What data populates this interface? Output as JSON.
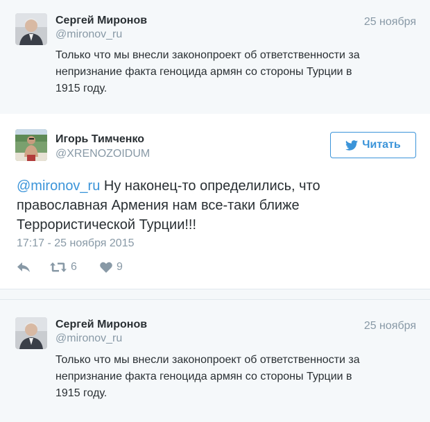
{
  "tweet_top": {
    "name": "Сергей Миронов",
    "handle": "@mironov_ru",
    "date": "25 ноября",
    "text_lines": [
      "Только что мы внесли законопроект об ответственности за",
      "непризнание факта геноцида армян со стороны Турции в",
      "1915 году."
    ],
    "avatar_icon": "avatar-portrait"
  },
  "tweet_main": {
    "name": "Игорь Тимченко",
    "handle": "@XRENOZOIDUM",
    "follow_label": "Читать",
    "mention": "@mironov_ru",
    "text_rest_line1": " Ну наконец-то определились, что",
    "text_line2": "православная Армения нам все-таки ближе",
    "text_line3": "Террористической Турции!!!",
    "timestamp": "17:17 - 25 ноября 2015",
    "retweets": "6",
    "likes": "9",
    "accent_color": "#3b94d9"
  },
  "tweet_bottom": {
    "name": "Сергей Миронов",
    "handle": "@mironov_ru",
    "date": "25 ноября",
    "text_lines": [
      "Только что мы внесли законопроект об ответственности за",
      "непризнание факта геноцида армян со стороны Турции в",
      "1915 году."
    ],
    "avatar_icon": "avatar-portrait"
  }
}
